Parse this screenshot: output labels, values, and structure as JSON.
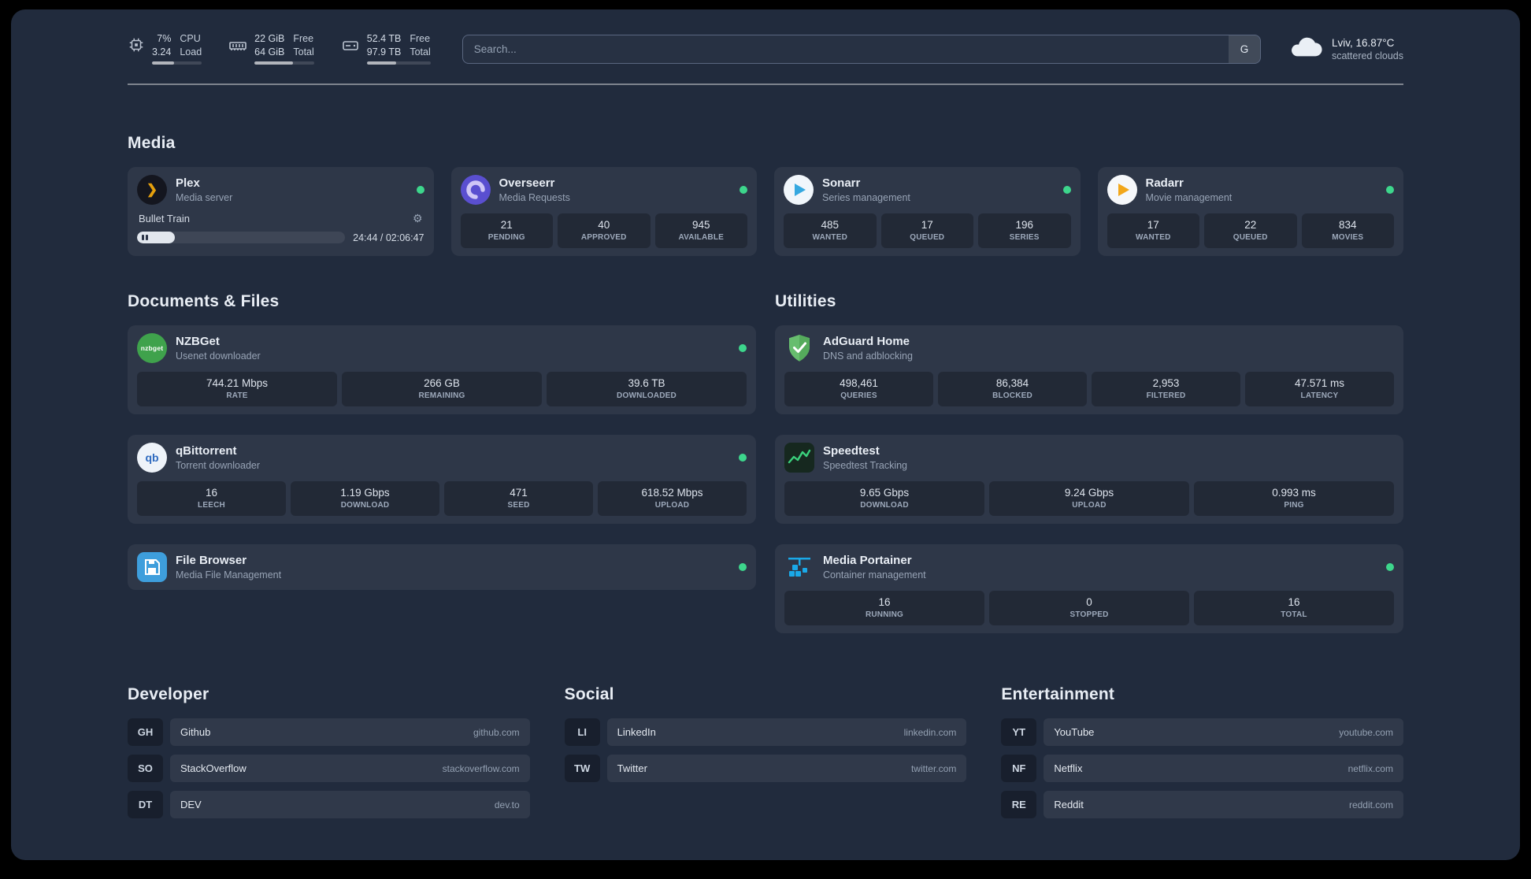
{
  "topbar": {
    "cpu": {
      "value1": "7%",
      "value2": "3.24",
      "label1": "CPU",
      "label2": "Load",
      "bar_percent": 45
    },
    "memory": {
      "value1": "22 GiB",
      "value2": "64 GiB",
      "label1": "Free",
      "label2": "Total",
      "bar_percent": 64
    },
    "disk": {
      "value1": "52.4 TB",
      "value2": "97.9 TB",
      "label1": "Free",
      "label2": "Total",
      "bar_percent": 46
    },
    "search": {
      "placeholder": "Search...",
      "provider": "G"
    },
    "weather": {
      "location": "Lviv, 16.87°C",
      "condition": "scattered clouds"
    }
  },
  "media": {
    "title": "Media",
    "cards": [
      {
        "name": "Plex",
        "desc": "Media server",
        "player": {
          "track": "Bullet Train",
          "time": "24:44 / 02:06:47",
          "progress_percent": 18
        }
      },
      {
        "name": "Overseerr",
        "desc": "Media Requests",
        "stats": [
          {
            "value": "21",
            "label": "PENDING"
          },
          {
            "value": "40",
            "label": "APPROVED"
          },
          {
            "value": "945",
            "label": "AVAILABLE"
          }
        ]
      },
      {
        "name": "Sonarr",
        "desc": "Series management",
        "stats": [
          {
            "value": "485",
            "label": "WANTED"
          },
          {
            "value": "17",
            "label": "QUEUED"
          },
          {
            "value": "196",
            "label": "SERIES"
          }
        ]
      },
      {
        "name": "Radarr",
        "desc": "Movie management",
        "stats": [
          {
            "value": "17",
            "label": "WANTED"
          },
          {
            "value": "22",
            "label": "QUEUED"
          },
          {
            "value": "834",
            "label": "MOVIES"
          }
        ]
      }
    ]
  },
  "documents": {
    "title": "Documents & Files",
    "cards": [
      {
        "name": "NZBGet",
        "desc": "Usenet downloader",
        "stats": [
          {
            "value": "744.21 Mbps",
            "label": "RATE"
          },
          {
            "value": "266 GB",
            "label": "REMAINING"
          },
          {
            "value": "39.6 TB",
            "label": "DOWNLOADED"
          }
        ]
      },
      {
        "name": "qBittorrent",
        "desc": "Torrent downloader",
        "stats": [
          {
            "value": "16",
            "label": "LEECH"
          },
          {
            "value": "1.19 Gbps",
            "label": "DOWNLOAD"
          },
          {
            "value": "471",
            "label": "SEED"
          },
          {
            "value": "618.52 Mbps",
            "label": "UPLOAD"
          }
        ]
      },
      {
        "name": "File Browser",
        "desc": "Media File Management",
        "stats": []
      }
    ]
  },
  "utilities": {
    "title": "Utilities",
    "cards": [
      {
        "name": "AdGuard Home",
        "desc": "DNS and adblocking",
        "stats": [
          {
            "value": "498,461",
            "label": "QUERIES"
          },
          {
            "value": "86,384",
            "label": "BLOCKED"
          },
          {
            "value": "2,953",
            "label": "FILTERED"
          },
          {
            "value": "47.571 ms",
            "label": "LATENCY"
          }
        ]
      },
      {
        "name": "Speedtest",
        "desc": "Speedtest Tracking",
        "stats": [
          {
            "value": "9.65 Gbps",
            "label": "DOWNLOAD"
          },
          {
            "value": "9.24 Gbps",
            "label": "UPLOAD"
          },
          {
            "value": "0.993 ms",
            "label": "PING"
          }
        ]
      },
      {
        "name": "Media Portainer",
        "desc": "Container management",
        "stats": [
          {
            "value": "16",
            "label": "RUNNING"
          },
          {
            "value": "0",
            "label": "STOPPED"
          },
          {
            "value": "16",
            "label": "TOTAL"
          }
        ]
      }
    ]
  },
  "bookmarks": {
    "groups": [
      {
        "title": "Developer",
        "items": [
          {
            "abbr": "GH",
            "name": "Github",
            "url": "github.com"
          },
          {
            "abbr": "SO",
            "name": "StackOverflow",
            "url": "stackoverflow.com"
          },
          {
            "abbr": "DT",
            "name": "DEV",
            "url": "dev.to"
          }
        ]
      },
      {
        "title": "Social",
        "items": [
          {
            "abbr": "LI",
            "name": "LinkedIn",
            "url": "linkedin.com"
          },
          {
            "abbr": "TW",
            "name": "Twitter",
            "url": "twitter.com"
          }
        ]
      },
      {
        "title": "Entertainment",
        "items": [
          {
            "abbr": "YT",
            "name": "YouTube",
            "url": "youtube.com"
          },
          {
            "abbr": "NF",
            "name": "Netflix",
            "url": "netflix.com"
          },
          {
            "abbr": "RE",
            "name": "Reddit",
            "url": "reddit.com"
          }
        ]
      }
    ]
  },
  "icon_labels": {
    "nzbget": "nzbget",
    "qbit": "qb",
    "plex": "❯"
  }
}
